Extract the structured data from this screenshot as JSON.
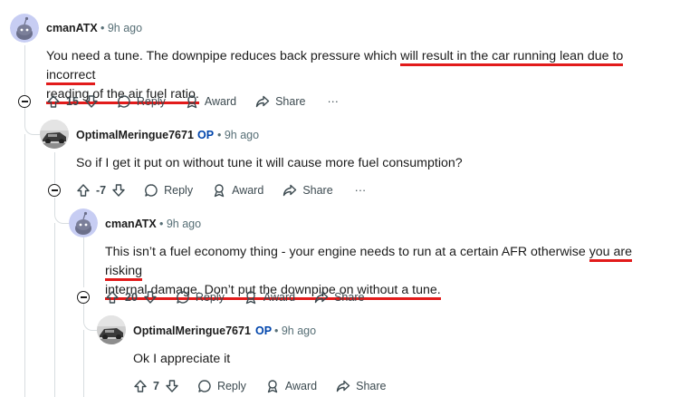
{
  "comments": [
    {
      "username": "cmanATX",
      "op_badge": "",
      "time": "• 9h ago",
      "body_before": "You need a tune. The downpipe reduces back pressure which ",
      "body_highlight_1": "will result in the car running lean due to incorrect",
      "body_highlight_2": "reading of the air fuel ratio.",
      "body_after": "",
      "score": "15",
      "reply_label": "Reply",
      "award_label": "Award",
      "share_label": "Share",
      "more_label": "···",
      "avatar": "reddit-snoo"
    },
    {
      "username": "OptimalMeringue7671",
      "op_badge": "OP",
      "time": "• 9h ago",
      "body": "So if I get it put on without tune it will cause more fuel consumption?",
      "score": "-7",
      "reply_label": "Reply",
      "award_label": "Award",
      "share_label": "Share",
      "more_label": "···",
      "avatar": "car-photo"
    },
    {
      "username": "cmanATX",
      "op_badge": "",
      "time": "• 9h ago",
      "body_before": "This isn’t a fuel economy thing - your engine needs to run at a certain AFR otherwise ",
      "body_highlight_1": "you are risking",
      "body_highlight_2": "internal damage. Don’t put the downpipe on without a tune.",
      "score": "20",
      "reply_label": "Reply",
      "award_label": "Award",
      "share_label": "Share",
      "avatar": "reddit-snoo"
    },
    {
      "username": "OptimalMeringue7671",
      "op_badge": "OP",
      "time": "• 9h ago",
      "body": "Ok I appreciate it",
      "score": "7",
      "reply_label": "Reply",
      "award_label": "Award",
      "share_label": "Share",
      "avatar": "car-photo"
    }
  ],
  "colors": {
    "highlight": "#e21b1b",
    "op": "#0045ac",
    "meta": "#576f76"
  }
}
